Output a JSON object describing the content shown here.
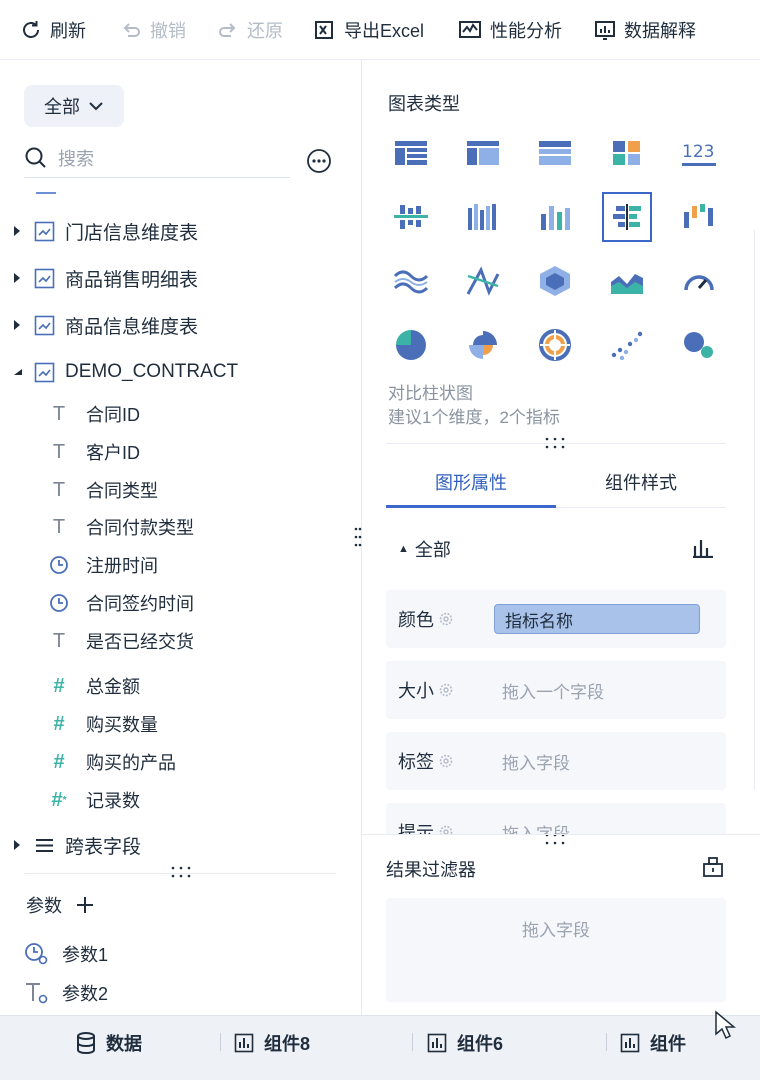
{
  "toolbar": {
    "refresh": "刷新",
    "undo": "撤销",
    "redo": "还原",
    "export": "导出Excel",
    "perf": "性能分析",
    "explain": "数据解释"
  },
  "left": {
    "scope": "全部",
    "search_placeholder": "搜索",
    "tables": [
      {
        "label": "门店信息维度表",
        "expanded": false
      },
      {
        "label": "商品销售明细表",
        "expanded": false
      },
      {
        "label": "商品信息维度表",
        "expanded": false
      },
      {
        "label": "DEMO_CONTRACT",
        "expanded": true
      }
    ],
    "fields": [
      {
        "label": "合同ID",
        "type": "text"
      },
      {
        "label": "客户ID",
        "type": "text"
      },
      {
        "label": "合同类型",
        "type": "text"
      },
      {
        "label": "合同付款类型",
        "type": "text"
      },
      {
        "label": "注册时间",
        "type": "time"
      },
      {
        "label": "合同签约时间",
        "type": "time"
      },
      {
        "label": "是否已经交货",
        "type": "text"
      },
      {
        "label": "总金额",
        "type": "number"
      },
      {
        "label": "购买数量",
        "type": "number"
      },
      {
        "label": "购买的产品",
        "type": "number"
      },
      {
        "label": "记录数",
        "type": "count"
      }
    ],
    "cross_table": "跨表字段",
    "params_title": "参数",
    "params": [
      {
        "label": "参数1",
        "type": "time"
      },
      {
        "label": "参数2",
        "type": "text"
      }
    ]
  },
  "right": {
    "chart_type_title": "图表类型",
    "selected_chart": "对比柱状图",
    "chart_hint": "建议1个维度，2个指标",
    "tabs": [
      "图形属性",
      "组件样式"
    ],
    "all_label": "全部",
    "props": [
      {
        "label": "颜色",
        "value": "指标名称",
        "placeholder": ""
      },
      {
        "label": "大小",
        "value": "",
        "placeholder": "拖入一个字段"
      },
      {
        "label": "标签",
        "value": "",
        "placeholder": "拖入字段"
      },
      {
        "label": "提示",
        "value": "",
        "placeholder": "拖入字段"
      }
    ],
    "filter_title": "结果过滤器",
    "filter_placeholder": "拖入字段"
  },
  "bottom": {
    "data_tab": "数据",
    "tabs": [
      "组件8",
      "组件6",
      "组件"
    ]
  },
  "colors": {
    "accent": "#3a67c9",
    "chip": "#a9c2ea",
    "teal": "#3bb3a6",
    "orange": "#f0a04b"
  }
}
